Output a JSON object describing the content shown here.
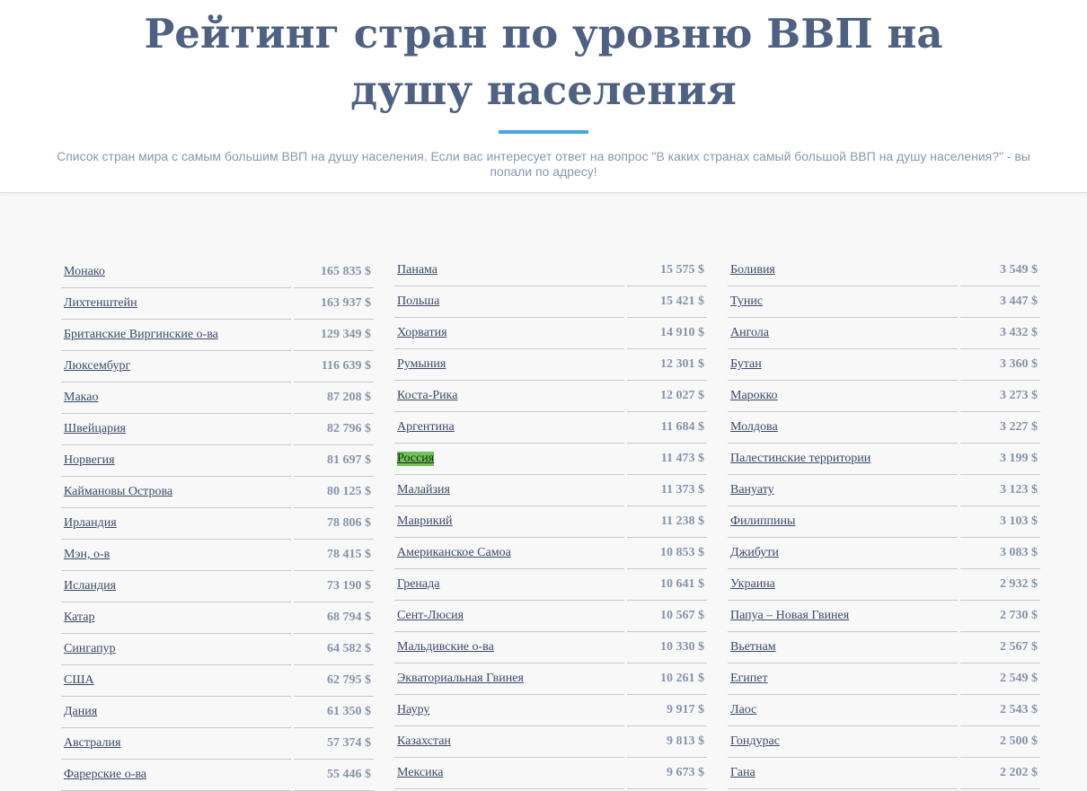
{
  "header": {
    "title": "Рейтинг стран по уровню ВВП на душу населения",
    "subtitle": "Список стран мира с самым большим ВВП на душу населения. Если вас интересует ответ на вопрос \"В каких странах самый большой ВВП на душу населения?\" - вы попали по адресу!"
  },
  "colors": {
    "title": "#4f6182",
    "accent": "#4aa8e0",
    "highlight": "#6cc35a"
  },
  "columns": [
    [
      {
        "name": "Монако",
        "value": "165 835 $"
      },
      {
        "name": "Лихтенштейн",
        "value": "163 937 $"
      },
      {
        "name": "Британские Виргинские о-ва",
        "value": "129 349 $"
      },
      {
        "name": "Люксембург",
        "value": "116 639 $"
      },
      {
        "name": "Макао",
        "value": "87 208 $"
      },
      {
        "name": "Швейцария",
        "value": "82 796 $"
      },
      {
        "name": "Норвегия",
        "value": "81 697 $"
      },
      {
        "name": "Каймановы Острова",
        "value": "80 125 $"
      },
      {
        "name": "Ирландия",
        "value": "78 806 $"
      },
      {
        "name": "Мэн, о-в",
        "value": "78 415 $"
      },
      {
        "name": "Исландия",
        "value": "73 190 $"
      },
      {
        "name": "Катар",
        "value": "68 794 $"
      },
      {
        "name": "Сингапур",
        "value": "64 582 $"
      },
      {
        "name": "США",
        "value": "62 795 $"
      },
      {
        "name": "Дания",
        "value": "61 350 $"
      },
      {
        "name": "Австралия",
        "value": "57 374 $"
      },
      {
        "name": "Фарерские о-ва",
        "value": "55 446 $"
      }
    ],
    [
      {
        "name": "Панама",
        "value": "15 575 $"
      },
      {
        "name": "Польша",
        "value": "15 421 $"
      },
      {
        "name": "Хорватия",
        "value": "14 910 $"
      },
      {
        "name": "Румыния",
        "value": "12 301 $"
      },
      {
        "name": "Коста-Рика",
        "value": "12 027 $"
      },
      {
        "name": "Аргентина",
        "value": "11 684 $"
      },
      {
        "name": "Россия",
        "value": "11 473 $",
        "highlighted": true
      },
      {
        "name": "Малайзия",
        "value": "11 373 $"
      },
      {
        "name": "Маврикий",
        "value": "11 238 $"
      },
      {
        "name": "Американское Самоа",
        "value": "10 853 $"
      },
      {
        "name": "Гренада",
        "value": "10 641 $"
      },
      {
        "name": "Сент-Люсия",
        "value": "10 567 $"
      },
      {
        "name": "Мальдивские о-ва",
        "value": "10 330 $"
      },
      {
        "name": "Экваториальная Гвинея",
        "value": "10 261 $"
      },
      {
        "name": "Науру",
        "value": "9 917 $"
      },
      {
        "name": "Казахстан",
        "value": "9 813 $"
      },
      {
        "name": "Мексика",
        "value": "9 673 $"
      }
    ],
    [
      {
        "name": "Боливия",
        "value": "3 549 $"
      },
      {
        "name": "Тунис",
        "value": "3 447 $"
      },
      {
        "name": "Ангола",
        "value": "3 432 $"
      },
      {
        "name": "Бутан",
        "value": "3 360 $"
      },
      {
        "name": "Марокко",
        "value": "3 273 $"
      },
      {
        "name": "Молдова",
        "value": "3 227 $"
      },
      {
        "name": "Палестинские территории",
        "value": "3 199 $"
      },
      {
        "name": "Вануату",
        "value": "3 123 $"
      },
      {
        "name": "Филиппины",
        "value": "3 103 $"
      },
      {
        "name": "Джибути",
        "value": "3 083 $"
      },
      {
        "name": "Украина",
        "value": "2 932 $"
      },
      {
        "name": "Папуа – Новая Гвинея",
        "value": "2 730 $"
      },
      {
        "name": "Вьетнам",
        "value": "2 567 $"
      },
      {
        "name": "Египет",
        "value": "2 549 $"
      },
      {
        "name": "Лаос",
        "value": "2 543 $"
      },
      {
        "name": "Гондурас",
        "value": "2 500 $"
      },
      {
        "name": "Гана",
        "value": "2 202 $"
      }
    ]
  ]
}
